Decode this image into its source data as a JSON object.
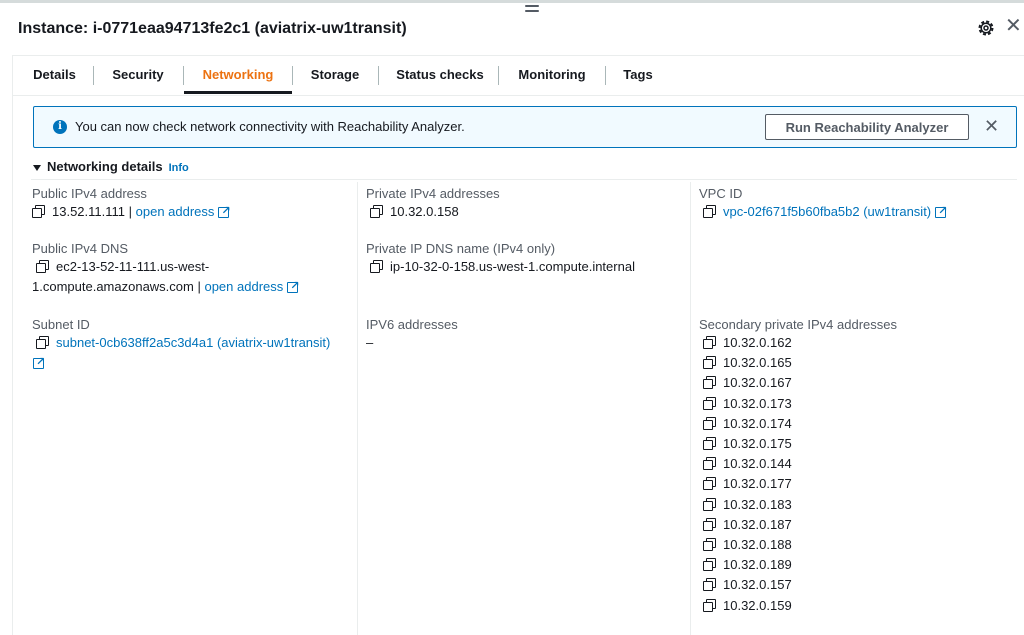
{
  "header": {
    "title": "Instance: i-0771eaa94713fe2c1 (aviatrix-uw1transit)"
  },
  "tabs": [
    {
      "label": "Details"
    },
    {
      "label": "Security"
    },
    {
      "label": "Networking",
      "active": true
    },
    {
      "label": "Storage"
    },
    {
      "label": "Status checks"
    },
    {
      "label": "Monitoring"
    },
    {
      "label": "Tags"
    }
  ],
  "alert": {
    "text": "You can now check network connectivity with Reachability Analyzer.",
    "button_label": "Run Reachability Analyzer"
  },
  "section": {
    "title": "Networking details",
    "info_label": "Info"
  },
  "fields": {
    "public_ipv4": {
      "label": "Public IPv4 address",
      "value": "13.52.11.111",
      "separator": " | ",
      "link": "open address"
    },
    "public_dns": {
      "label": "Public IPv4 DNS",
      "value_line1": "ec2-13-52-11-111.us-west-",
      "value_line2": "1.compute.amazonaws.com",
      "separator": " | ",
      "link": "open address"
    },
    "subnet_id": {
      "label": "Subnet ID",
      "value": "subnet-0cb638ff2a5c3d4a1 (aviatrix-uw1transit)"
    },
    "private_ipv4": {
      "label": "Private IPv4 addresses",
      "value": "10.32.0.158"
    },
    "private_dns": {
      "label": "Private IP DNS name (IPv4 only)",
      "value": "ip-10-32-0-158.us-west-1.compute.internal"
    },
    "ipv6": {
      "label": "IPV6 addresses",
      "value": "–"
    },
    "vpc_id": {
      "label": "VPC ID",
      "value": "vpc-02f671f5b60fba5b2 (uw1transit)"
    },
    "secondary": {
      "label": "Secondary private IPv4 addresses",
      "values": [
        "10.32.0.162",
        "10.32.0.165",
        "10.32.0.167",
        "10.32.0.173",
        "10.32.0.174",
        "10.32.0.175",
        "10.32.0.144",
        "10.32.0.177",
        "10.32.0.183",
        "10.32.0.187",
        "10.32.0.188",
        "10.32.0.189",
        "10.32.0.157",
        "10.32.0.159"
      ]
    }
  },
  "colors": {
    "accent_tab": "#ec7211",
    "link": "#0073bb",
    "alert_bg": "#f1faff"
  }
}
